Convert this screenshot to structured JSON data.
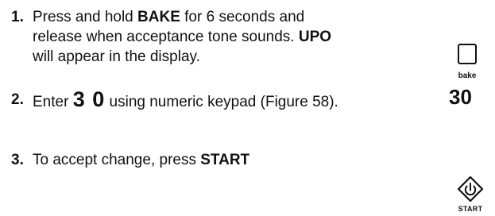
{
  "steps": [
    {
      "number": "1.",
      "parts": [
        "Press and hold ",
        "BAKE",
        " for 6 seconds and release when acceptance tone sounds. ",
        "UPO",
        " will appear in the display."
      ]
    },
    {
      "number": "2.",
      "parts": [
        "Enter ",
        "3 0",
        " using numeric keypad (Figure 58)."
      ]
    },
    {
      "number": "3.",
      "parts": [
        "To accept change, press ",
        "START"
      ]
    }
  ],
  "keys": {
    "bake_label": "bake",
    "entry_value": "30",
    "start_label": "START"
  },
  "icons": {
    "bake": "bake-key-icon",
    "start": "start-key-icon"
  }
}
